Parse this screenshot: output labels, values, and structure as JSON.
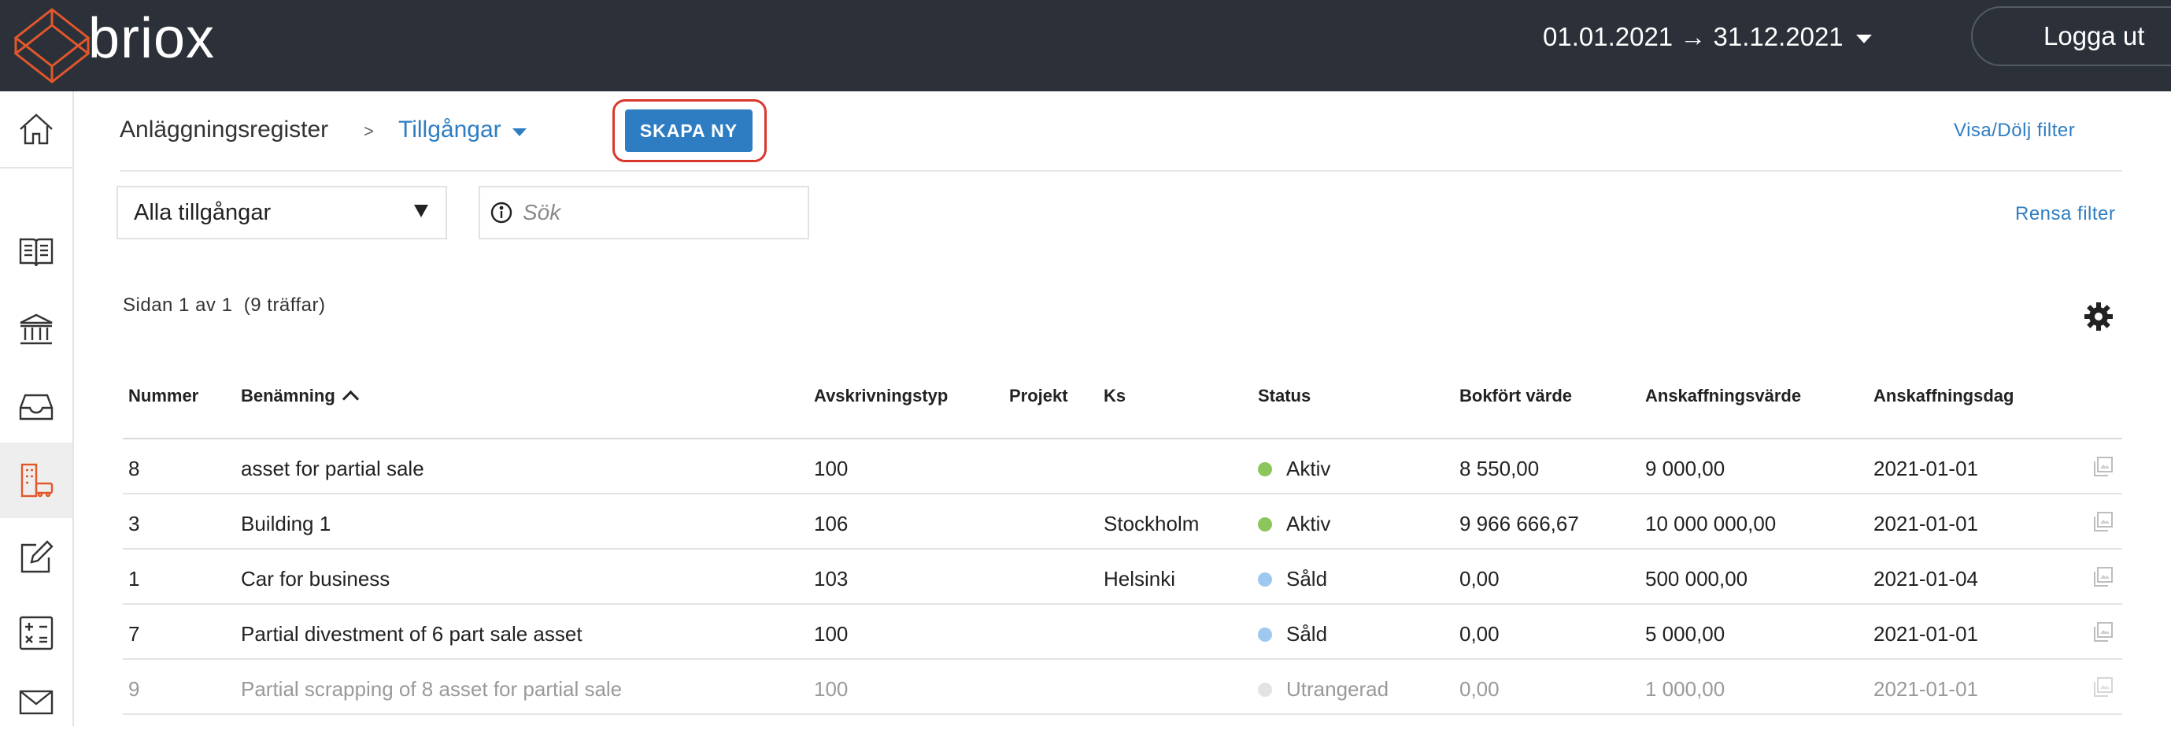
{
  "header": {
    "logo_text": "briox",
    "date_range": "01.01.2021 → 31.12.2021",
    "logout_label": "Logga ut"
  },
  "sidebar": {
    "items": [
      {
        "icon": "home-icon"
      },
      {
        "icon": "book-icon"
      },
      {
        "icon": "bank-icon"
      },
      {
        "icon": "inbox-icon"
      },
      {
        "icon": "asset-register-icon",
        "active": true
      },
      {
        "icon": "edit-icon"
      },
      {
        "icon": "calculator-icon"
      },
      {
        "icon": "mail-icon"
      }
    ]
  },
  "breadcrumb": {
    "root": "Anläggningsregister",
    "separator": ">",
    "current": "Tillgångar"
  },
  "toolbar": {
    "create_label": "SKAPA NY",
    "toggle_filter_label": "Visa/Dölj filter",
    "clear_filter_label": "Rensa filter"
  },
  "filters": {
    "asset_select_value": "Alla tillgångar",
    "search_placeholder": "Sök"
  },
  "pagination": {
    "text": "Sidan 1 av 1  (9 träffar)"
  },
  "table": {
    "columns": {
      "number": "Nummer",
      "name": "Benämning",
      "depreciation_type": "Avskrivningstyp",
      "project": "Projekt",
      "cost_center": "Ks",
      "status": "Status",
      "book_value": "Bokfört värde",
      "acquisition_value": "Anskaffningsvärde",
      "acquisition_date": "Anskaffningsdag"
    },
    "status_colors": {
      "Aktiv": "#8cc65a",
      "Såld": "#9ec8f0",
      "Utrangerad": "#e3e3e3"
    },
    "rows": [
      {
        "number": "8",
        "name": "asset for partial sale",
        "depreciation_type": "100",
        "project": "",
        "cost_center": "",
        "status": "Aktiv",
        "book_value": "8 550,00",
        "acquisition_value": "9 000,00",
        "acquisition_date": "2021-01-01",
        "muted": false
      },
      {
        "number": "3",
        "name": "Building 1",
        "depreciation_type": "106",
        "project": "",
        "cost_center": "Stockholm",
        "status": "Aktiv",
        "book_value": "9 966 666,67",
        "acquisition_value": "10 000 000,00",
        "acquisition_date": "2021-01-01",
        "muted": false
      },
      {
        "number": "1",
        "name": "Car for business",
        "depreciation_type": "103",
        "project": "",
        "cost_center": "Helsinki",
        "status": "Såld",
        "book_value": "0,00",
        "acquisition_value": "500 000,00",
        "acquisition_date": "2021-01-04",
        "muted": false
      },
      {
        "number": "7",
        "name": "Partial divestment of 6 part sale asset",
        "depreciation_type": "100",
        "project": "",
        "cost_center": "",
        "status": "Såld",
        "book_value": "0,00",
        "acquisition_value": "5 000,00",
        "acquisition_date": "2021-01-01",
        "muted": false
      },
      {
        "number": "9",
        "name": "Partial scrapping of 8 asset for partial sale",
        "depreciation_type": "100",
        "project": "",
        "cost_center": "",
        "status": "Utrangerad",
        "book_value": "0,00",
        "acquisition_value": "1 000,00",
        "acquisition_date": "2021-01-01",
        "muted": true
      }
    ]
  }
}
